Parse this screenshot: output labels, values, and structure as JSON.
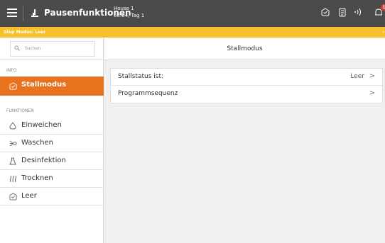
{
  "topbar": {
    "title": "Pausenfunktionen",
    "house": "House 1",
    "time_day": "08:04, Tag 1",
    "notification_count": "1",
    "accent": "#4a4a4a"
  },
  "stopbar": {
    "text": "Stop Modus: Leer",
    "arrow": "‹",
    "color": "#f7c02b"
  },
  "sidebar": {
    "search_placeholder": "Suchen",
    "info_label": "INFO",
    "functions_label": "FUNKTIONEN",
    "active_item": {
      "label": "Stallmodus",
      "icon": "status-icon",
      "color": "#e8731e"
    },
    "items": [
      {
        "label": "Einweichen",
        "icon": "drop-icon"
      },
      {
        "label": "Waschen",
        "icon": "spray-icon"
      },
      {
        "label": "Desinfektion",
        "icon": "flask-icon"
      },
      {
        "label": "Trocknen",
        "icon": "heat-icon"
      },
      {
        "label": "Leer",
        "icon": "status-icon"
      }
    ]
  },
  "main": {
    "title": "Stallmodus",
    "rows": [
      {
        "label": "Stallstatus ist:",
        "value": "Leer",
        "chevron": ">"
      },
      {
        "label": "Programmsequenz",
        "value": "",
        "chevron": ">"
      }
    ]
  }
}
